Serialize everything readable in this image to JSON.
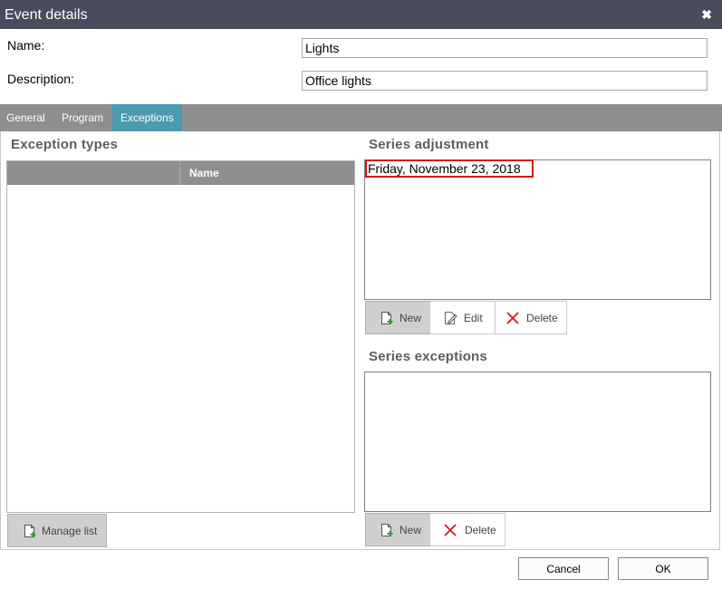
{
  "window": {
    "title": "Event details",
    "close_glyph": "✖"
  },
  "form": {
    "name_label": "Name:",
    "name_value": "Lights",
    "description_label": "Description:",
    "description_value": "Office lights"
  },
  "tabs": [
    {
      "label": "General",
      "active": false
    },
    {
      "label": "Program",
      "active": false
    },
    {
      "label": "Exceptions",
      "active": true
    }
  ],
  "exception_types": {
    "heading": "Exception types",
    "columns": [
      "",
      "Name"
    ],
    "rows": [],
    "manage_label": "Manage list"
  },
  "series_adjustment": {
    "heading": "Series adjustment",
    "items": [
      "Friday, November 23, 2018"
    ],
    "new_label": "New",
    "edit_label": "Edit",
    "delete_label": "Delete"
  },
  "series_exceptions": {
    "heading": "Series exceptions",
    "items": [],
    "new_label": "New",
    "delete_label": "Delete"
  },
  "footer": {
    "cancel_label": "Cancel",
    "ok_label": "OK"
  },
  "colors": {
    "titlebar": "#4a4c5c",
    "tabbar": "#8f8f8f",
    "active_tab": "#4a9bb2",
    "selection_outline": "#d4141a",
    "delete_icon": "#cc1a1a",
    "new_icon_plus": "#2e9e3a"
  },
  "icons": {
    "close": "close-icon",
    "new": "new-document-icon",
    "edit": "edit-pencil-icon",
    "delete": "delete-x-icon",
    "manage": "new-document-icon"
  }
}
